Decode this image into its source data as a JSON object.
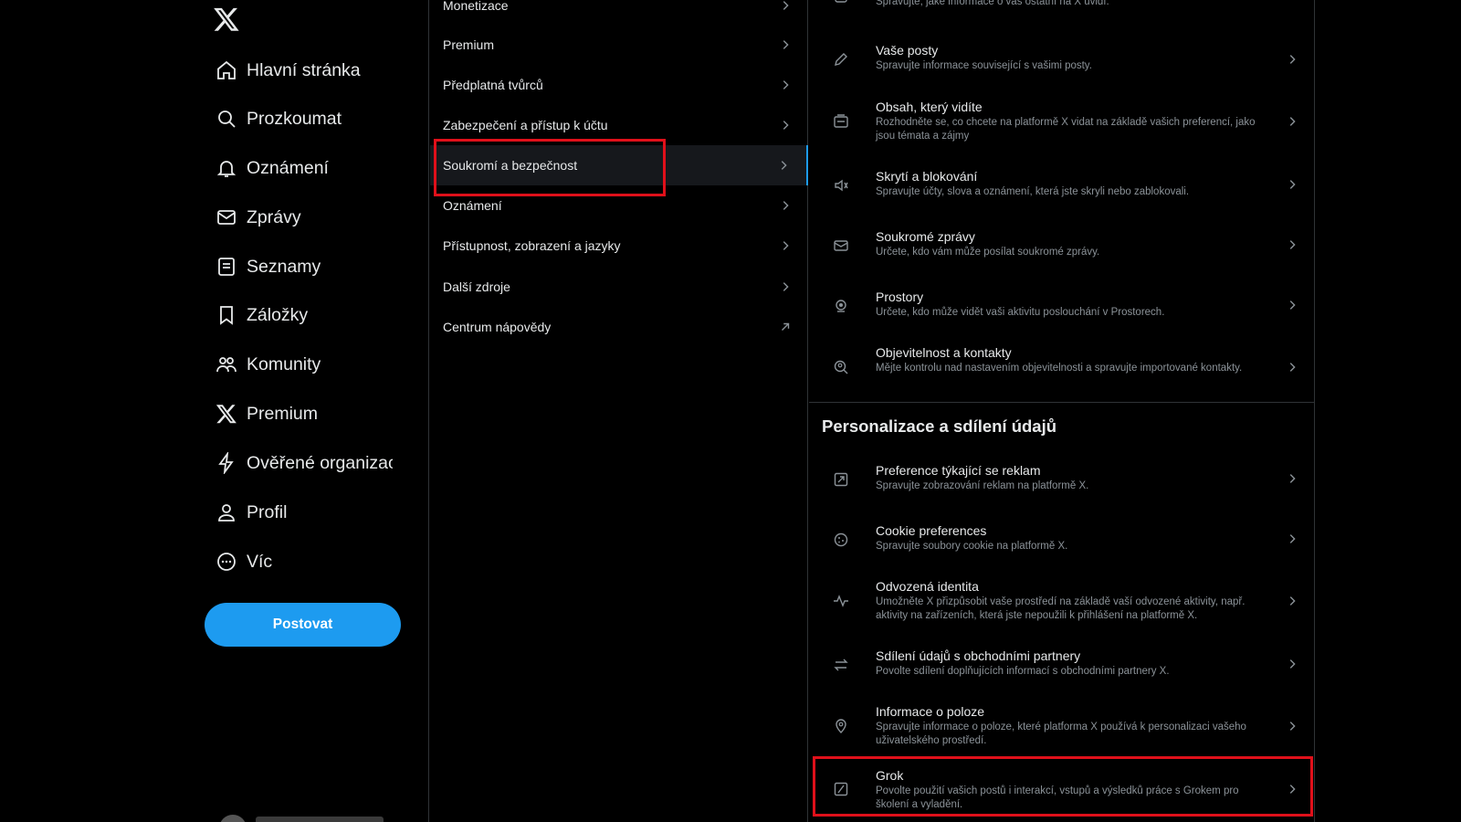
{
  "nav": {
    "items": [
      {
        "label": "Hlavní stránka",
        "icon": "home-icon"
      },
      {
        "label": "Prozkoumat",
        "icon": "search-icon"
      },
      {
        "label": "Oznámení",
        "icon": "bell-icon"
      },
      {
        "label": "Zprávy",
        "icon": "mail-icon"
      },
      {
        "label": "Seznamy",
        "icon": "list-icon"
      },
      {
        "label": "Záložky",
        "icon": "bookmark-icon"
      },
      {
        "label": "Komunity",
        "icon": "people-icon"
      },
      {
        "label": "Premium",
        "icon": "x-logo-icon"
      },
      {
        "label": "Ověřené organizace",
        "icon": "lightning-icon"
      },
      {
        "label": "Profil",
        "icon": "person-icon"
      },
      {
        "label": "Víc",
        "icon": "more-circle-icon"
      }
    ],
    "post_label": "Postovat"
  },
  "menu": {
    "items": [
      {
        "label": "Monetizace"
      },
      {
        "label": "Premium"
      },
      {
        "label": "Předplatná tvůrců"
      },
      {
        "label": "Zabezpečení a přístup k účtu"
      },
      {
        "label": "Soukromí a bezpečnost",
        "active": true
      },
      {
        "label": "Oznámení"
      },
      {
        "label": "Přístupnost, zobrazení a jazyky"
      },
      {
        "label": "Další zdroje"
      },
      {
        "label": "Centrum nápovědy",
        "external": true
      }
    ]
  },
  "detail": {
    "top_items": [
      {
        "title": "",
        "desc": "Spravujte, jaké informace o vás ostatní na X uvidí.",
        "icon": "audience-icon"
      },
      {
        "title": "Vaše posty",
        "desc": "Spravujte informace související s vašimi posty.",
        "icon": "pencil-icon"
      },
      {
        "title": "Obsah, který vidíte",
        "desc": "Rozhodněte se, co chcete na platformě X vidat na základě vašich preferencí, jako jsou témata a zájmy",
        "icon": "content-icon"
      },
      {
        "title": "Skrytí a blokování",
        "desc": "Spravujte účty, slova a oznámení, která jste skryli nebo zablokovali.",
        "icon": "mute-icon"
      },
      {
        "title": "Soukromé zprávy",
        "desc": "Určete, kdo vám může posílat soukromé zprávy.",
        "icon": "envelope-icon"
      },
      {
        "title": "Prostory",
        "desc": "Určete, kdo může vidět vaši aktivitu poslouchání v Prostorech.",
        "icon": "spaces-icon"
      },
      {
        "title": "Objevitelnost a kontakty",
        "desc": "Mějte kontrolu nad nastavením objevitelnosti a spravujte importované kontakty.",
        "icon": "discover-icon"
      }
    ],
    "section_title": "Personalizace a sdílení údajů",
    "section_items": [
      {
        "title": "Preference týkající se reklam",
        "desc": "Spravujte zobrazování reklam na platformě X.",
        "icon": "ad-icon"
      },
      {
        "title": "Cookie preferences",
        "desc": "Spravujte soubory cookie na platformě X.",
        "icon": "cookie-icon"
      },
      {
        "title": "Odvozená identita",
        "desc": "Umožněte X přizpůsobit vaše prostředí na základě vaší odvozené aktivity, např. aktivity na zařízeních, která jste nepoužili k přihlášení na platformě X.",
        "icon": "activity-icon"
      },
      {
        "title": "Sdílení údajů s obchodními partnery",
        "desc": "Povolte sdílení doplňujících informací s obchodními partnery X.",
        "icon": "swap-icon"
      },
      {
        "title": "Informace o poloze",
        "desc": "Spravujte informace o poloze, které platforma X používá k personalizaci vašeho uživatelského prostředí.",
        "icon": "location-icon"
      },
      {
        "title": "Grok",
        "desc": "Povolte použití vašich postů i interakcí, vstupů a výsledků práce s Grokem pro školení a vyladění.",
        "icon": "grok-icon"
      }
    ]
  },
  "colors": {
    "accent": "#1d9bf0",
    "highlight": "#e0101a",
    "background": "#000000",
    "muted_text": "#8b9298"
  }
}
